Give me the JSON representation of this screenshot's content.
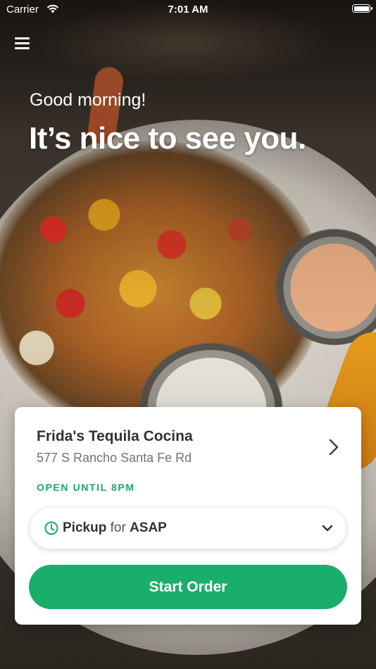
{
  "status_bar": {
    "carrier": "Carrier",
    "time": "7:01 AM"
  },
  "header": {
    "greeting": "Good morning!",
    "headline": "It’s nice to see you."
  },
  "store_card": {
    "name": "Frida's Tequila Cocina",
    "address": "577 S Rancho Santa Fe Rd",
    "hours_status": "OPEN UNTIL 8PM",
    "order_mode": {
      "mode": "Pickup",
      "connector": "for",
      "time": "ASAP"
    },
    "cta_label": "Start Order"
  },
  "colors": {
    "accent_green": "#1aae6b",
    "open_green": "#1aa865",
    "text_dark": "#2f3236"
  },
  "icons": [
    "menu-icon",
    "wifi-icon",
    "battery-icon",
    "chevron-right-icon",
    "clock-icon",
    "chevron-down-icon"
  ]
}
